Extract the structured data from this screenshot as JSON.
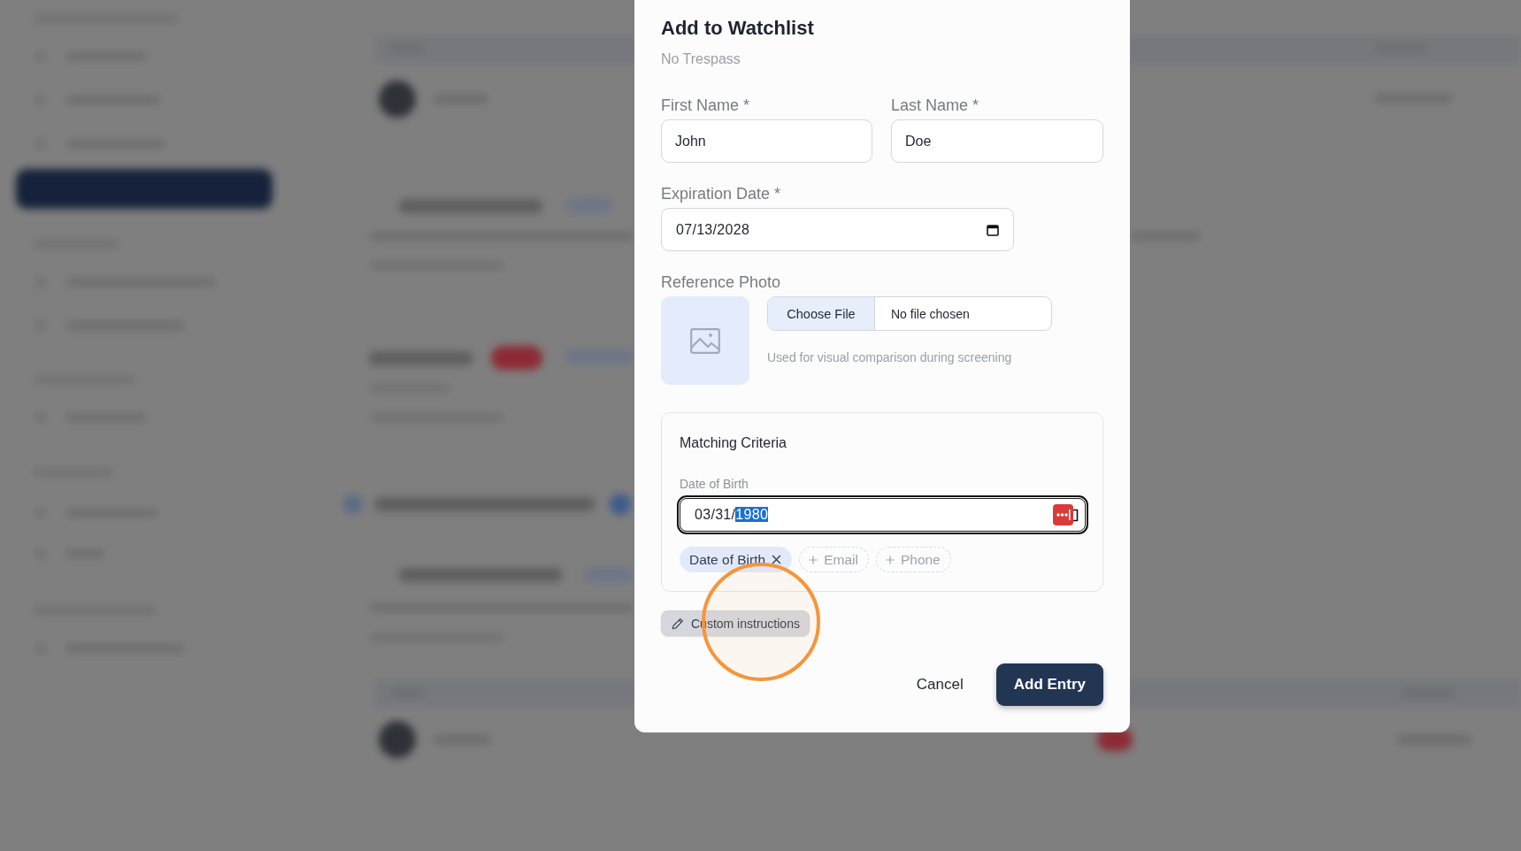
{
  "dialog": {
    "title": "Add to Watchlist",
    "subtitle": "No Trespass",
    "name_fields": [
      {
        "label": "First Name *",
        "value": "John"
      },
      {
        "label": "Last Name *",
        "value": "Doe"
      }
    ],
    "expiration_date": {
      "label": "Expiration Date *",
      "value": "07/13/2028"
    },
    "reference_photo": {
      "label": "Reference Photo",
      "button": "Choose File",
      "status": "No file chosen",
      "help": "Used for visual comparison during screening"
    },
    "matching_criteria": {
      "title": "Matching Criteria",
      "field_label": "Date of Birth",
      "focused": true,
      "value_parts": [
        {
          "text": "03/31/",
          "selected": false
        },
        {
          "text": "1980",
          "selected": true
        }
      ],
      "chips": [
        {
          "label": "Date of Birth",
          "selected": true
        },
        {
          "label": "Email",
          "selected": false
        },
        {
          "label": "Phone",
          "selected": false
        }
      ]
    },
    "custom_instructions_button": "Custom instructions",
    "buttons": [
      {
        "label": "Cancel",
        "kind": "secondary"
      },
      {
        "label": "Add Entry",
        "kind": "primary"
      }
    ]
  }
}
